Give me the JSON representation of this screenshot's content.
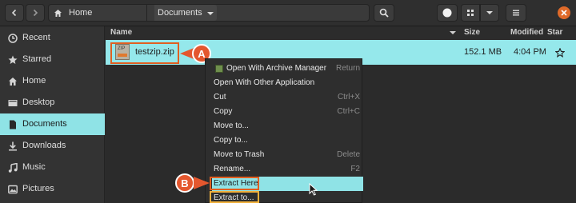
{
  "header": {
    "breadcrumb": [
      {
        "label": "Home",
        "icon": "home-icon"
      },
      {
        "label": "Documents",
        "icon": "chevron-down-icon"
      }
    ]
  },
  "sidebar": {
    "items": [
      {
        "label": "Recent",
        "icon": "clock-icon"
      },
      {
        "label": "Starred",
        "icon": "star-icon"
      },
      {
        "label": "Home",
        "icon": "home-icon"
      },
      {
        "label": "Desktop",
        "icon": "desktop-icon"
      },
      {
        "label": "Documents",
        "icon": "document-icon",
        "active": true
      },
      {
        "label": "Downloads",
        "icon": "download-icon"
      },
      {
        "label": "Music",
        "icon": "music-icon"
      },
      {
        "label": "Pictures",
        "icon": "picture-icon"
      }
    ]
  },
  "columns": {
    "name": "Name",
    "size": "Size",
    "modified": "Modified",
    "star": "Star"
  },
  "file": {
    "name": "testzip.zip",
    "size": "152.1 MB",
    "modified": "4:04 PM",
    "icon_text": "ZIP"
  },
  "context_menu": {
    "items": [
      {
        "label": "Open With Archive Manager",
        "shortcut": "Return",
        "icon": "archive-icon"
      },
      {
        "label": "Open With Other Application",
        "shortcut": ""
      },
      {
        "label": "Cut",
        "shortcut": "Ctrl+X"
      },
      {
        "label": "Copy",
        "shortcut": "Ctrl+C"
      },
      {
        "label": "Move to...",
        "shortcut": ""
      },
      {
        "label": "Copy to...",
        "shortcut": ""
      },
      {
        "label": "Move to Trash",
        "shortcut": "Delete"
      },
      {
        "label": "Rename...",
        "shortcut": "F2"
      },
      {
        "label": "Extract Here",
        "shortcut": "",
        "highlighted": true
      },
      {
        "label": "Extract to...",
        "shortcut": ""
      }
    ]
  },
  "annotations": {
    "a": "A",
    "b": "B"
  },
  "colors": {
    "accent": "#8fe3e6",
    "callout": "#e15f21",
    "close": "#e06a29"
  }
}
